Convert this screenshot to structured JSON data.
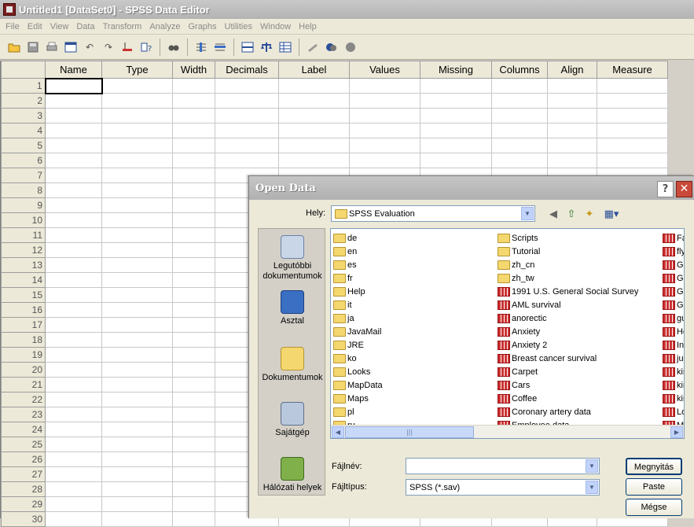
{
  "window": {
    "title": "Untitled1 [DataSet0] - SPSS Data Editor"
  },
  "menu": [
    "File",
    "Edit",
    "View",
    "Data",
    "Transform",
    "Analyze",
    "Graphs",
    "Utilities",
    "Window",
    "Help"
  ],
  "toolbar_icons": [
    "open-icon",
    "save-icon",
    "print-icon",
    "dialog-recall-icon",
    "undo-icon",
    "redo-icon",
    "goto-case-icon",
    "variables-icon",
    "find-icon",
    "insert-cases-icon",
    "insert-variable-icon",
    "split-file-icon",
    "weight-cases-icon",
    "select-cases-icon",
    "value-labels-icon",
    "use-sets-icon",
    "show-all-icon"
  ],
  "grid": {
    "columns": [
      "Name",
      "Type",
      "Width",
      "Decimals",
      "Label",
      "Values",
      "Missing",
      "Columns",
      "Align",
      "Measure"
    ],
    "rows": [
      "1",
      "2",
      "3",
      "4",
      "5",
      "6",
      "7",
      "8",
      "9",
      "10",
      "11",
      "12",
      "13",
      "14",
      "15",
      "16",
      "17",
      "18",
      "19",
      "20",
      "21",
      "22",
      "23",
      "24",
      "25",
      "26",
      "27",
      "28",
      "29",
      "30"
    ]
  },
  "dialog": {
    "title": "Open Data",
    "help": "?",
    "close": "✕",
    "look_in_label": "Hely:",
    "look_in_value": "SPSS Evaluation",
    "places": [
      "Legutóbbi dokumentumok",
      "Asztal",
      "Dokumentumok",
      "Sajátgép",
      "Hálózati helyek"
    ],
    "col1": [
      "de",
      "en",
      "es",
      "fr",
      "Help",
      "it",
      "ja",
      "JavaMail",
      "JRE",
      "ko",
      "Looks",
      "MapData",
      "Maps",
      "pl",
      "ru"
    ],
    "col2_folders": [
      "Scripts",
      "Tutorial",
      "zh_cn",
      "zh_tw"
    ],
    "col2_files": [
      "1991 U.S. General Social Survey",
      "AML survival",
      "anorectic",
      "Anxiety",
      "Anxiety 2",
      "Breast cancer survival",
      "Carpet",
      "Cars",
      "Coffee",
      "Coronary artery data",
      "Employee data"
    ],
    "col3": [
      "Fa",
      "fly",
      "Gl",
      "Gr",
      "GS",
      "GS",
      "gu",
      "He",
      "In",
      "ju",
      "kir",
      "kir",
      "kir",
      "Lo",
      "M"
    ],
    "filename_label": "Fájlnév:",
    "filename_value": "",
    "filetype_label": "Fájltípus:",
    "filetype_value": "SPSS (*.sav)",
    "open_button": "Megnyitás",
    "paste_button": "Paste",
    "cancel_button": "Mégse"
  }
}
